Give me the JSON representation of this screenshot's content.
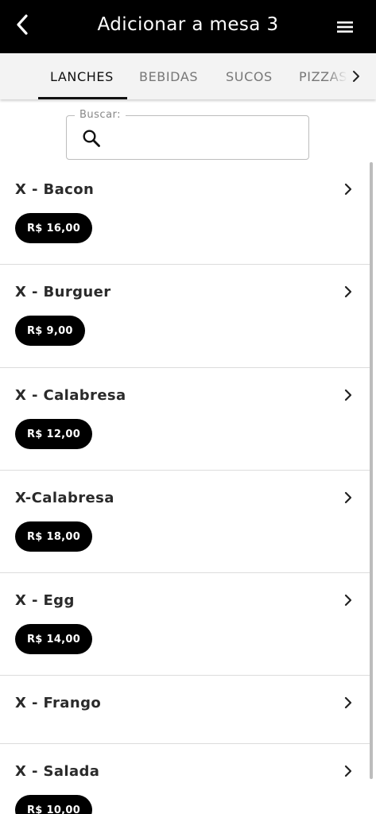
{
  "header": {
    "title": "Adicionar a mesa 3",
    "back_icon": "chevron-left-icon",
    "menu_icon": "hamburger-menu-icon"
  },
  "tabs": [
    {
      "label": "LANCHES",
      "active": true
    },
    {
      "label": "BEBIDAS",
      "active": false
    },
    {
      "label": "SUCOS",
      "active": false
    },
    {
      "label": "PIZZAS",
      "active": false
    }
  ],
  "search": {
    "legend": "Buscar:",
    "value": "",
    "placeholder": ""
  },
  "products": [
    {
      "name": "X - Bacon",
      "price": "R$ 16,00"
    },
    {
      "name": "X - Burguer",
      "price": "R$ 9,00"
    },
    {
      "name": "X - Calabresa",
      "price": "R$ 12,00"
    },
    {
      "name": "X-Calabresa",
      "price": "R$ 18,00"
    },
    {
      "name": "X - Egg",
      "price": "R$ 14,00"
    },
    {
      "name": "X - Frango",
      "price": ""
    },
    {
      "name": "X - Salada",
      "price": "R$ 10,00"
    }
  ],
  "colors": {
    "appbar": "#000000",
    "tabs_background": "#f3f3f3",
    "price_badge": "#000000"
  }
}
